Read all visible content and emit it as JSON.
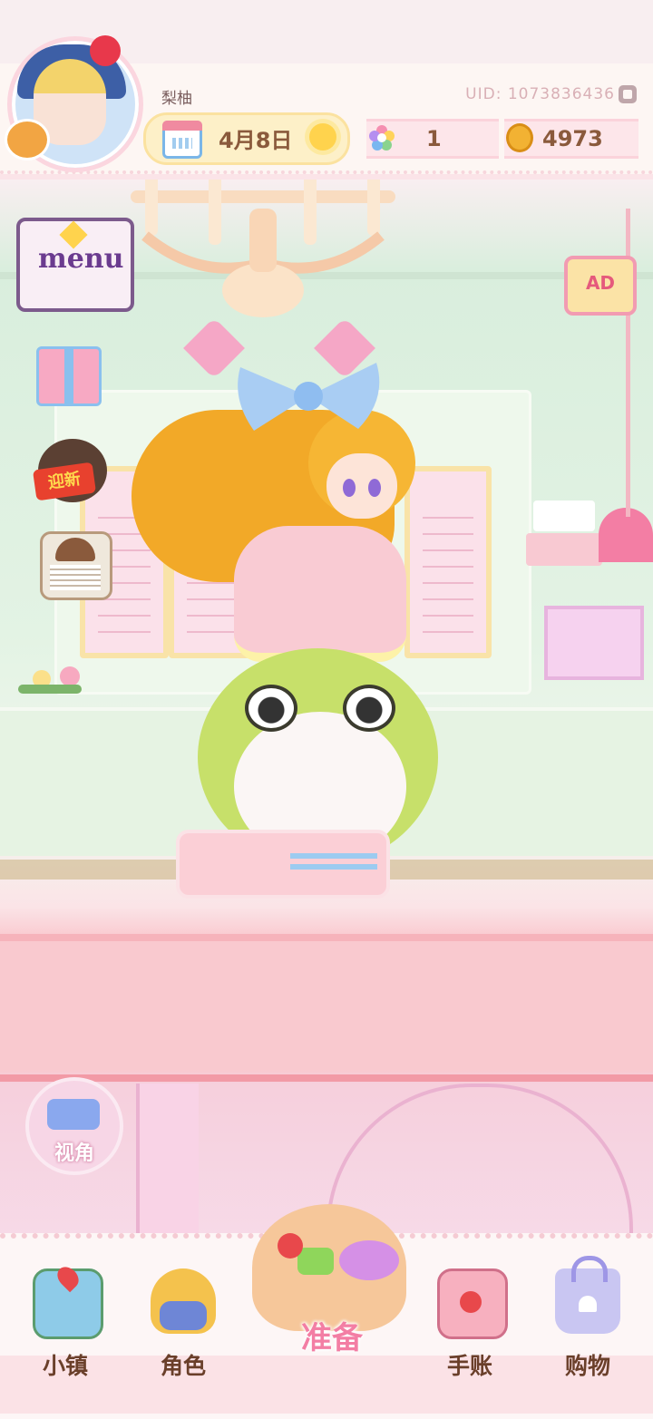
{
  "header": {
    "player_name": "梨柚",
    "uid_label": "UID: 1073836436",
    "date": "4月8日",
    "gems": "1",
    "coins": "4973"
  },
  "side_buttons": {
    "menu_label": "menu",
    "event_label": "迎新",
    "ad_label": "AD",
    "view_label": "视角"
  },
  "nav": {
    "items": [
      {
        "label": "小镇",
        "icon": "map-icon"
      },
      {
        "label": "角色",
        "icon": "character-icon"
      },
      {
        "label": "准备",
        "icon": "basket-icon"
      },
      {
        "label": "手账",
        "icon": "journal-icon"
      },
      {
        "label": "购物",
        "icon": "shopping-bag-icon"
      }
    ]
  },
  "colors": {
    "accent_pink": "#f37ea4",
    "label_brown": "#6a3f2a",
    "coin_gold": "#f2b233"
  }
}
